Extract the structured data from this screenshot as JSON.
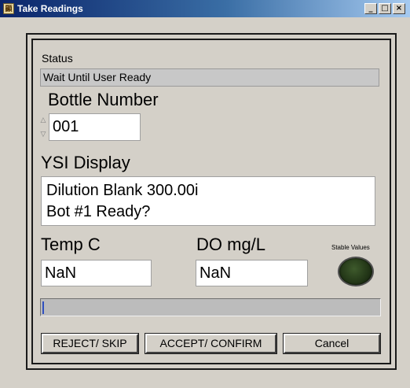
{
  "window": {
    "title": "Take Readings",
    "icon_glyph": "顯",
    "minimize_glyph": "_",
    "maximize_glyph": "□",
    "close_glyph": "×"
  },
  "status": {
    "label": "Status",
    "value": "Wait Until User Ready"
  },
  "bottle": {
    "label": "Bottle Number",
    "value": "001",
    "spin_up_glyph": "△",
    "spin_down_glyph": "▽"
  },
  "ysi": {
    "label": "YSI Display",
    "line1": "Dilution Blank 300.00i",
    "line2": "Bot #1 Ready?"
  },
  "temp": {
    "label": "Temp C",
    "value": "NaN"
  },
  "do": {
    "label": "DO mg/L",
    "value": "NaN"
  },
  "stable": {
    "label": "Stable Values",
    "led_on": false,
    "led_color_off": "#2a4020"
  },
  "progress": {
    "value": 0
  },
  "buttons": {
    "reject": "REJECT/ SKIP",
    "accept": "ACCEPT/ CONFIRM",
    "cancel": "Cancel"
  }
}
